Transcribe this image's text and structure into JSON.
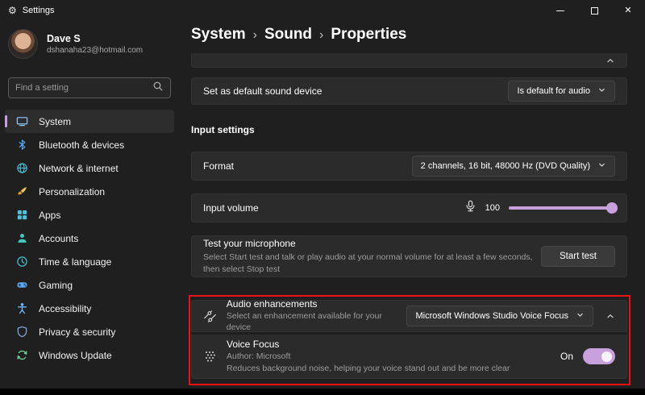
{
  "titlebar": {
    "app_title": "Settings",
    "gear_glyph": "⚙",
    "close_glyph": "✕"
  },
  "sidebar": {
    "user": {
      "name": "Dave S",
      "email": "dshanaha23@hotmail.com"
    },
    "search": {
      "placeholder": "Find a setting"
    },
    "items": [
      {
        "label": "System",
        "icon": "monitor-icon",
        "selected": true
      },
      {
        "label": "Bluetooth & devices",
        "icon": "bluetooth-icon",
        "selected": false
      },
      {
        "label": "Network & internet",
        "icon": "globe-icon",
        "selected": false
      },
      {
        "label": "Personalization",
        "icon": "brush-icon",
        "selected": false
      },
      {
        "label": "Apps",
        "icon": "apps-icon",
        "selected": false
      },
      {
        "label": "Accounts",
        "icon": "person-icon",
        "selected": false
      },
      {
        "label": "Time & language",
        "icon": "clock-icon",
        "selected": false
      },
      {
        "label": "Gaming",
        "icon": "gamepad-icon",
        "selected": false
      },
      {
        "label": "Accessibility",
        "icon": "accessibility-icon",
        "selected": false
      },
      {
        "label": "Privacy & security",
        "icon": "shield-icon",
        "selected": false
      },
      {
        "label": "Windows Update",
        "icon": "update-icon",
        "selected": false
      }
    ]
  },
  "breadcrumb": {
    "separator": "›",
    "segments": [
      "System",
      "Sound",
      "Properties"
    ]
  },
  "main": {
    "default_device_row": {
      "label": "Set as default sound device",
      "dropdown_value": "Is default for audio"
    },
    "input_settings_header": "Input settings",
    "format_row": {
      "label": "Format",
      "dropdown_value": "2 channels, 16 bit, 48000 Hz (DVD Quality)"
    },
    "input_volume_row": {
      "label": "Input volume",
      "value": "100",
      "percent": 100
    },
    "test_mic_row": {
      "title": "Test your microphone",
      "description": "Select Start test and talk or play audio at your normal volume for at least a few seconds, then select Stop test",
      "button_label": "Start test"
    },
    "audio_enhancements_row": {
      "title": "Audio enhancements",
      "description": "Select an enhancement available for your device",
      "dropdown_value": "Microsoft Windows Studio Voice Focus"
    },
    "voice_focus_row": {
      "title": "Voice Focus",
      "author": "Author: Microsoft",
      "description": "Reduces background noise, helping your voice stand out and be more clear",
      "toggle_label": "On",
      "toggle_state": "on"
    }
  },
  "colors": {
    "accent": "#c8a0dc",
    "annotation": "#ee1111",
    "card": "#2b2b2b",
    "window": "#1f1f1f"
  }
}
